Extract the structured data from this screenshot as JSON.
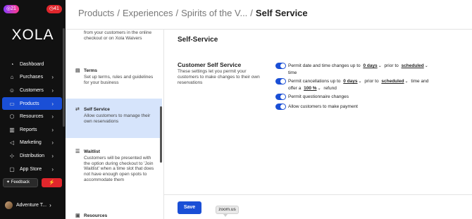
{
  "topbar": {
    "badge_left": "21",
    "badge_right": "41"
  },
  "brand": {
    "logo": "XOLA"
  },
  "nav": [
    {
      "label": "Dashboard",
      "icon": "dashboard-icon"
    },
    {
      "label": "Purchases",
      "icon": "tag-icon"
    },
    {
      "label": "Customers",
      "icon": "users-icon"
    },
    {
      "label": "Products",
      "icon": "products-icon",
      "active": true
    },
    {
      "label": "Resources",
      "icon": "resources-icon"
    },
    {
      "label": "Reports",
      "icon": "bar-chart-icon"
    },
    {
      "label": "Marketing",
      "icon": "megaphone-icon"
    },
    {
      "label": "Distribution",
      "icon": "distribution-icon"
    },
    {
      "label": "App Store",
      "icon": "app-store-icon"
    }
  ],
  "feedback": {
    "label": "Feedback"
  },
  "account": {
    "name": "Adventure T..."
  },
  "breadcrumb": [
    "Products",
    "Experiences",
    "Spirits of the V...",
    "Self Service"
  ],
  "settings_list": [
    {
      "title": "",
      "desc": "from your customers in the online checkout or on Xola Waivers"
    },
    {
      "title": "Terms",
      "desc": "Set up terms, rules and guidelines for your business"
    },
    {
      "title": "Self Service",
      "desc": "Allow customers to manage their own reservations",
      "active": true
    },
    {
      "title": "Waitlist",
      "desc": "Customers will be presented with the option during checkout to 'Join Waitlist' when a time slot that does not have enough open spots to accommodate them"
    },
    {
      "title": "Resources",
      "desc": ""
    }
  ],
  "main": {
    "heading": "Self-Service",
    "section_title": "Customer Self Service",
    "section_desc": "These settings let you permit your customers to make changes to their own reservations",
    "options": {
      "date_time": {
        "text1": "Permit date and time changes up to",
        "sel1": "0 days",
        "text2": "prior to",
        "sel2": "scheduled",
        "text3": "time"
      },
      "cancel": {
        "text1": "Permit cancellations up to",
        "sel1": "0 days",
        "text2": "prior to",
        "sel2": "scheduled",
        "text3": "time and offer a",
        "sel3": "100 %",
        "text4": "refund"
      },
      "questionnaire": "Permit questionnaire changes",
      "payment": "Allow customers to make payment"
    },
    "save_label": "Save",
    "tooltip": "zoom.us"
  },
  "colors": {
    "accent": "#1a4fd6",
    "sidebar": "#111111",
    "active_row": "#d6e4fb"
  }
}
